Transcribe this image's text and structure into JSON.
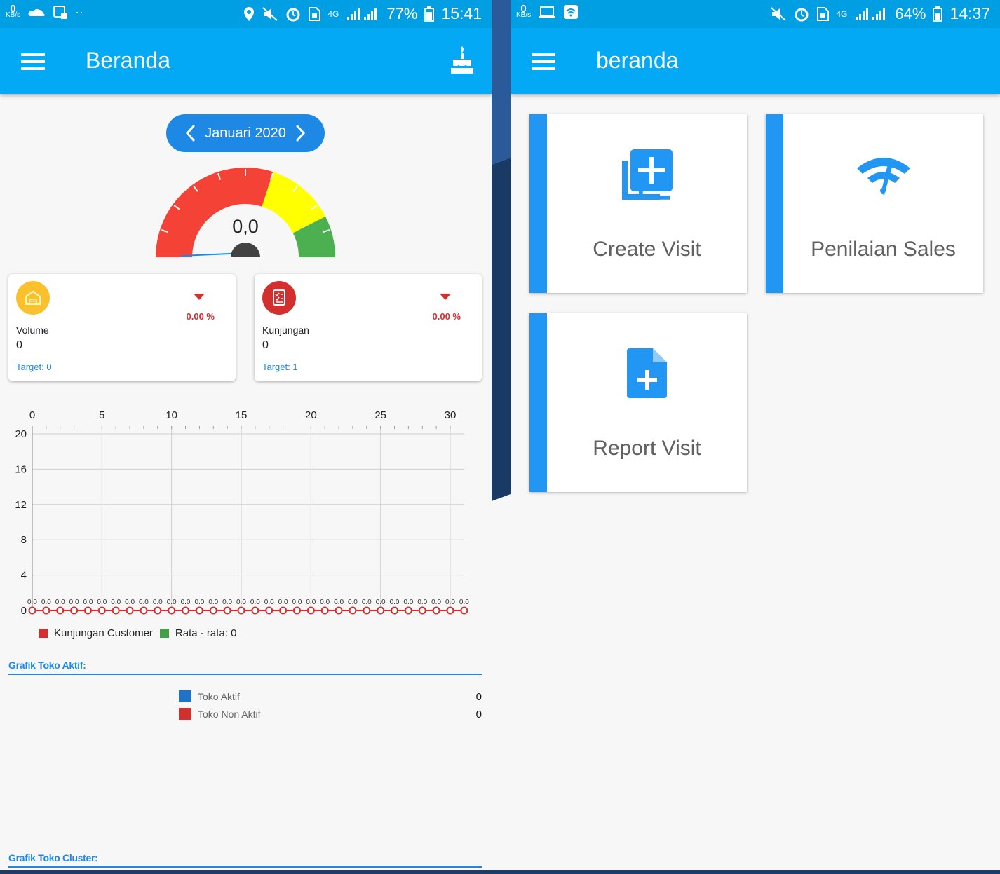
{
  "left": {
    "status": {
      "kbs_value": "0",
      "kbs_unit": "KB/s",
      "battery": "77%",
      "time": "15:41",
      "network": "4G"
    },
    "title": "Beranda",
    "month": "Januari 2020",
    "gauge": {
      "value_label": "0,0",
      "value": 0.0
    },
    "cards": [
      {
        "name": "Volume",
        "value": "0",
        "target": "Target: 0",
        "change": "0.00 %"
      },
      {
        "name": "Kunjungan",
        "value": "0",
        "target": "Target: 1",
        "change": "0.00 %"
      }
    ],
    "legend": {
      "series1": "Kunjungan Customer",
      "series2": "Rata - rata: 0"
    },
    "section_active": "Grafik Toko Aktif:",
    "active_legend": [
      {
        "label": "Toko Aktif",
        "value": "0",
        "color": "#1e73c8"
      },
      {
        "label": "Toko Non Aktif",
        "value": "0",
        "color": "#d32f2f"
      }
    ],
    "section_cluster": "Grafik Toko Cluster:"
  },
  "right": {
    "status": {
      "kbs_value": "0",
      "kbs_unit": "KB/s",
      "battery": "64%",
      "time": "14:37",
      "network": "4G"
    },
    "title": "beranda",
    "tiles": [
      {
        "label": "Create Visit",
        "icon": "add-library-icon"
      },
      {
        "label": "Penilaian Sales",
        "icon": "speedometer-wifi-icon"
      },
      {
        "label": "Report Visit",
        "icon": "add-document-icon"
      }
    ]
  },
  "colors": {
    "primary": "#03a9f4",
    "accent": "#2196f3",
    "gauge_red": "#f44336",
    "gauge_yellow": "#ffff00",
    "gauge_green": "#4caf50"
  },
  "chart_data": {
    "type": "line",
    "x": [
      0,
      1,
      2,
      3,
      4,
      5,
      6,
      7,
      8,
      9,
      10,
      11,
      12,
      13,
      14,
      15,
      16,
      17,
      18,
      19,
      20,
      21,
      22,
      23,
      24,
      25,
      26,
      27,
      28,
      29,
      30,
      31
    ],
    "x_ticks": [
      0,
      5,
      10,
      15,
      20,
      25,
      30
    ],
    "y_ticks": [
      0,
      4,
      8,
      12,
      16,
      20
    ],
    "ylim": [
      0,
      20
    ],
    "xlim": [
      0,
      31
    ],
    "series": [
      {
        "name": "Kunjungan Customer",
        "color": "#d32f2f",
        "values": [
          0,
          0,
          0,
          0,
          0,
          0,
          0,
          0,
          0,
          0,
          0,
          0,
          0,
          0,
          0,
          0,
          0,
          0,
          0,
          0,
          0,
          0,
          0,
          0,
          0,
          0,
          0,
          0,
          0,
          0,
          0,
          0
        ],
        "point_label": "0.0"
      },
      {
        "name": "Rata - rata: 0",
        "color": "#43a047",
        "values": [
          0,
          0,
          0,
          0,
          0,
          0,
          0,
          0,
          0,
          0,
          0,
          0,
          0,
          0,
          0,
          0,
          0,
          0,
          0,
          0,
          0,
          0,
          0,
          0,
          0,
          0,
          0,
          0,
          0,
          0,
          0,
          0
        ]
      }
    ],
    "grid": true,
    "x_axis_position": "top",
    "legend": "bottom-left"
  }
}
